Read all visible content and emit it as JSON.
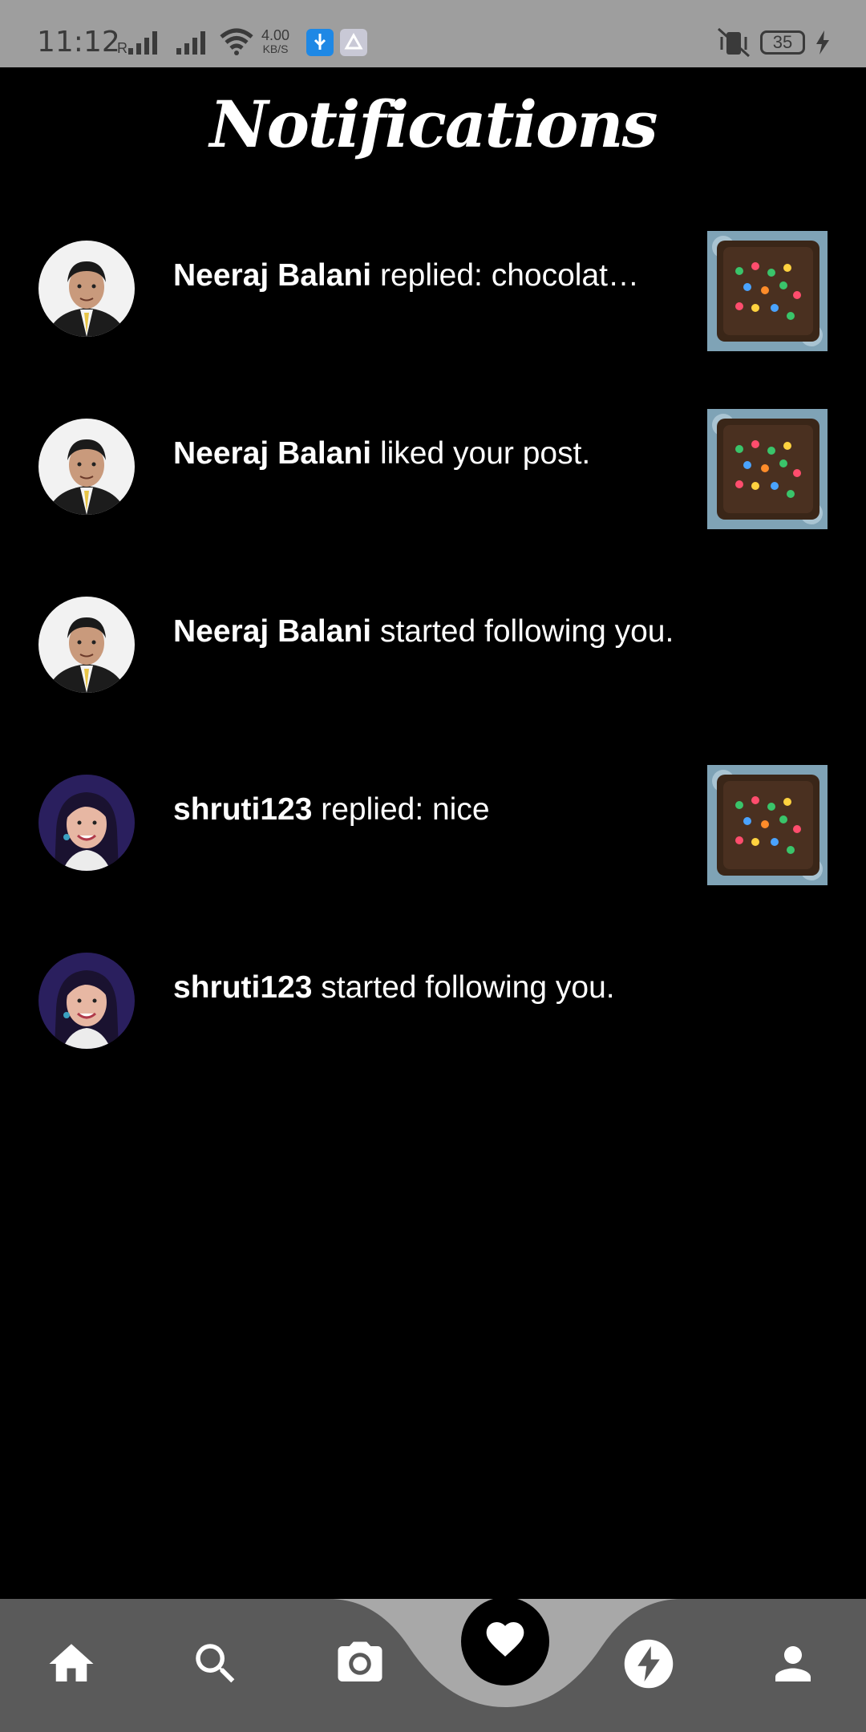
{
  "status_bar": {
    "time": "11:12",
    "speed_value": "4.00",
    "speed_unit": "KB/S",
    "battery": "35",
    "carrier_indicator": "R"
  },
  "header": {
    "title": "Notifications"
  },
  "notifications": [
    {
      "user": "Neeraj Balani",
      "message": " replied: chocolat…",
      "avatar": "man-avatar",
      "has_thumbnail": true
    },
    {
      "user": "Neeraj Balani",
      "message": " liked your post.",
      "avatar": "man-avatar",
      "has_thumbnail": true
    },
    {
      "user": "Neeraj Balani",
      "message": " started following you.",
      "avatar": "man-avatar",
      "has_thumbnail": false
    },
    {
      "user": "shruti123",
      "message": " replied: nice",
      "avatar": "woman-avatar",
      "has_thumbnail": true
    },
    {
      "user": "shruti123",
      "message": " started following you.",
      "avatar": "woman-avatar",
      "has_thumbnail": false
    }
  ],
  "bottom_nav": {
    "items": [
      "home-icon",
      "search-icon",
      "camera-icon",
      "heart-icon",
      "bolt-icon",
      "person-icon"
    ],
    "active": "heart-icon"
  },
  "colors": {
    "background": "#000000",
    "nav_background": "#5a5a5a",
    "nav_bump": "#a8a8a8",
    "status_bar": "#9e9e9e"
  }
}
